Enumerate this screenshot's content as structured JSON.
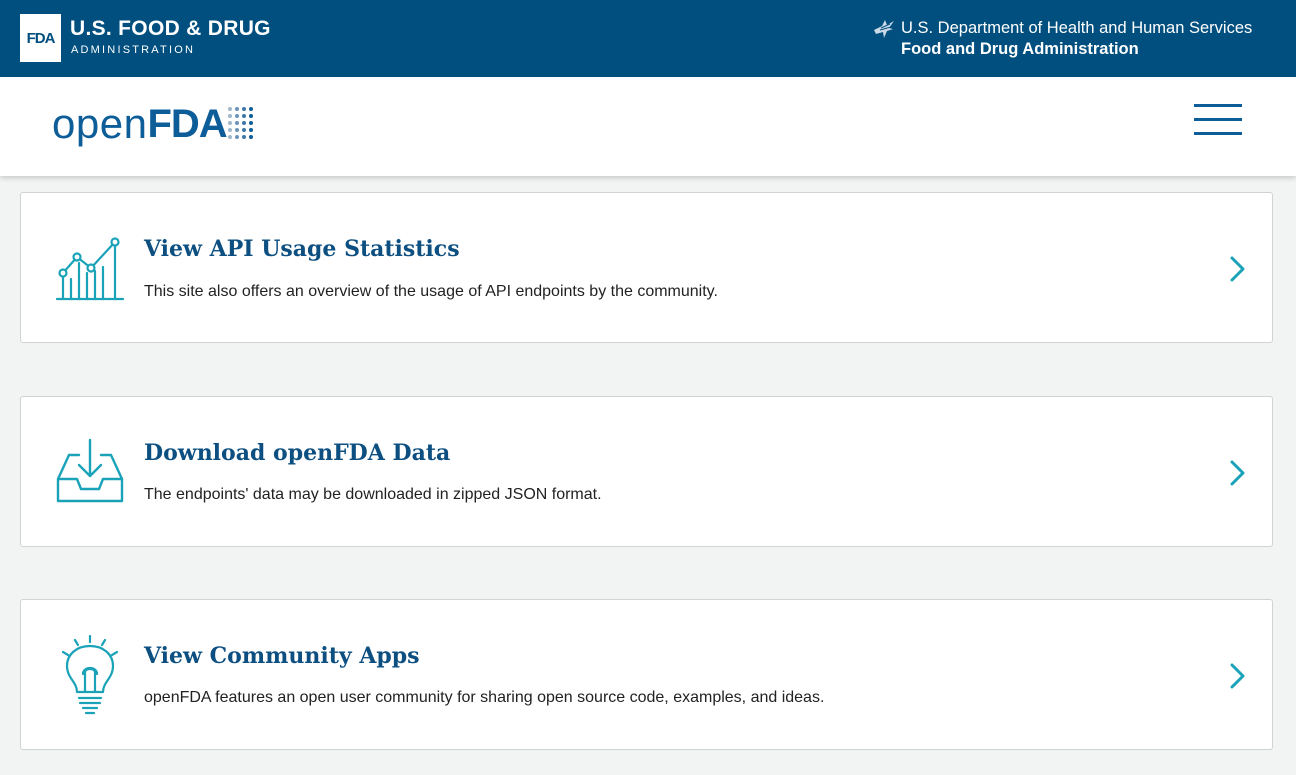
{
  "banner": {
    "badge": "FDA",
    "agency_name": "U.S. FOOD & DRUG",
    "agency_sub": "ADMINISTRATION",
    "hhs_line1": "U.S. Department of Health and Human Services",
    "hhs_line2": "Food and Drug Administration"
  },
  "header": {
    "logo_open": "open",
    "logo_fda": "FDA"
  },
  "cards": [
    {
      "title": "View API Usage Statistics",
      "description": "This site also offers an overview of the usage of API endpoints by the community."
    },
    {
      "title": "Download openFDA Data",
      "description": "The endpoints' data may be downloaded in zipped JSON format."
    },
    {
      "title": "View Community Apps",
      "description": "openFDA features an open user community for sharing open source code, examples, and ideas."
    }
  ],
  "colors": {
    "banner_bg": "#004f7f",
    "brand_blue": "#0d5d99",
    "accent_teal": "#1aa3b8",
    "page_bg": "#f2f3f3"
  },
  "icons": [
    "hhs-eagle-icon",
    "menu-icon",
    "chart-icon",
    "download-tray-icon",
    "lightbulb-icon",
    "chevron-right-icon"
  ]
}
